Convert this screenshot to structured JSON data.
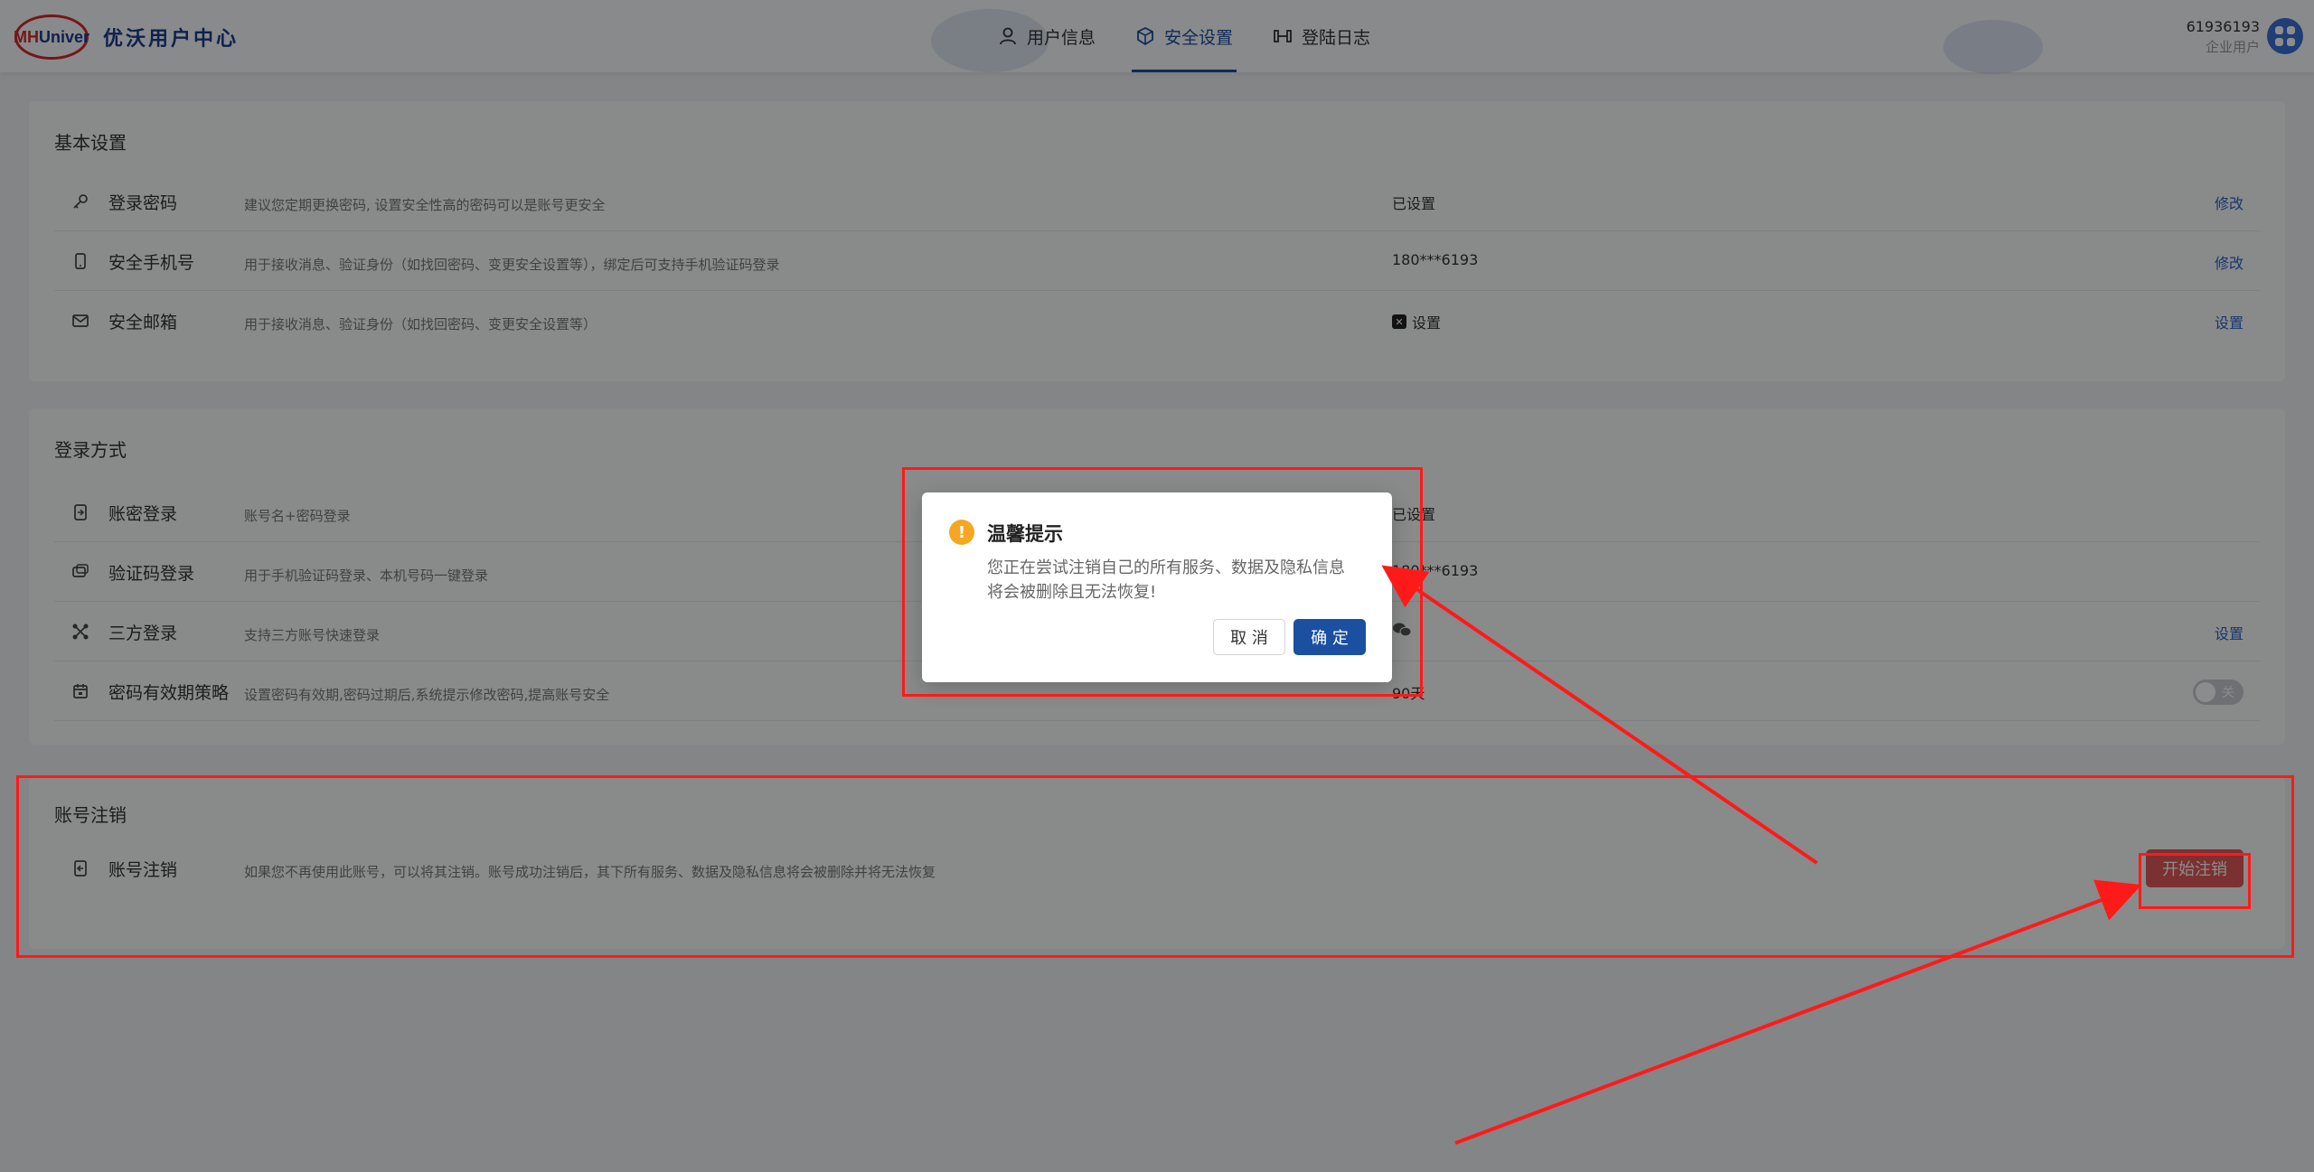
{
  "header": {
    "logo_mark_1": "MH",
    "logo_mark_2": "Univer",
    "logo_text": "优沃用户中心",
    "nav": [
      {
        "label": "用户信息",
        "icon": "user-icon"
      },
      {
        "label": "安全设置",
        "icon": "shield-icon",
        "active": true
      },
      {
        "label": "登陆日志",
        "icon": "log-icon"
      }
    ],
    "user_id": "61936193",
    "user_type": "企业用户"
  },
  "basic": {
    "title": "基本设置",
    "rows": [
      {
        "icon": "key-icon",
        "name": "登录密码",
        "desc": "建议您定期更换密码, 设置安全性高的密码可以是账号更安全",
        "status": "已设置",
        "action": "修改"
      },
      {
        "icon": "phone-icon",
        "name": "安全手机号",
        "desc": "用于接收消息、验证身份（如找回密码、变更安全设置等），绑定后可支持手机验证码登录",
        "status": "180***6193",
        "action": "修改"
      },
      {
        "icon": "mail-icon",
        "name": "安全邮箱",
        "desc": "用于接收消息、验证身份（如找回密码、变更安全设置等）",
        "status_mark": "✕",
        "status": "设置",
        "action": "设置"
      }
    ]
  },
  "login": {
    "title": "登录方式",
    "rows": [
      {
        "icon": "account-login-icon",
        "name": "账密登录",
        "desc": "账号名+密码登录",
        "status": "已设置"
      },
      {
        "icon": "sms-login-icon",
        "name": "验证码登录",
        "desc": "用于手机验证码登录、本机号码一键登录",
        "status": "180***6193"
      },
      {
        "icon": "third-party-icon",
        "name": "三方登录",
        "desc": "支持三方账号快速登录",
        "action": "设置"
      },
      {
        "icon": "calendar-icon",
        "name": "密码有效期策略",
        "desc": "设置密码有效期,密码过期后,系统提示修改密码,提高账号安全",
        "status": "90天",
        "toggle": "关"
      }
    ]
  },
  "cancel": {
    "title": "账号注销",
    "row": {
      "icon": "cancel-account-icon",
      "name": "账号注销",
      "desc": "如果您不再使用此账号，可以将其注销。账号成功注销后，其下所有服务、数据及隐私信息将会被删除并将无法恢复",
      "button": "开始注销"
    }
  },
  "modal": {
    "warn_mark": "!",
    "title": "温馨提示",
    "body": "您正在尝试注销自己的所有服务、数据及隐私信息将会被删除且无法恢复!",
    "cancel": "取 消",
    "ok": "确 定"
  },
  "colors": {
    "primary": "#1b4fa0",
    "danger": "#e05a5a",
    "annotation": "#ff1a1a",
    "warning": "#f5a623"
  }
}
